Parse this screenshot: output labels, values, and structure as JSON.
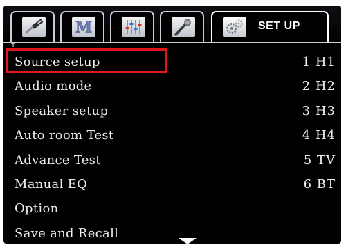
{
  "tabs": [
    {
      "name": "cable-input-icon"
    },
    {
      "name": "music-m-icon"
    },
    {
      "name": "equalizer-sliders-icon"
    },
    {
      "name": "microphone-icon"
    },
    {
      "name": "gears-icon",
      "label": "SET UP",
      "active": true
    }
  ],
  "menu": {
    "items": [
      {
        "label": "Source setup",
        "source": "1 H1",
        "selected": true
      },
      {
        "label": "Audio mode",
        "source": "2 H2"
      },
      {
        "label": "Speaker setup",
        "source": "3 H3"
      },
      {
        "label": "Auto room Test",
        "source": "4 H4"
      },
      {
        "label": "Advance Test",
        "source": "5 TV"
      },
      {
        "label": "Manual EQ",
        "source": "6 BT"
      },
      {
        "label": "Option",
        "source": ""
      },
      {
        "label": "Save and Recall",
        "source": ""
      }
    ]
  },
  "colors": {
    "background": "#000000",
    "text": "#ececec",
    "highlight": "#e1151b",
    "tab_border": "#c9ccd2"
  }
}
